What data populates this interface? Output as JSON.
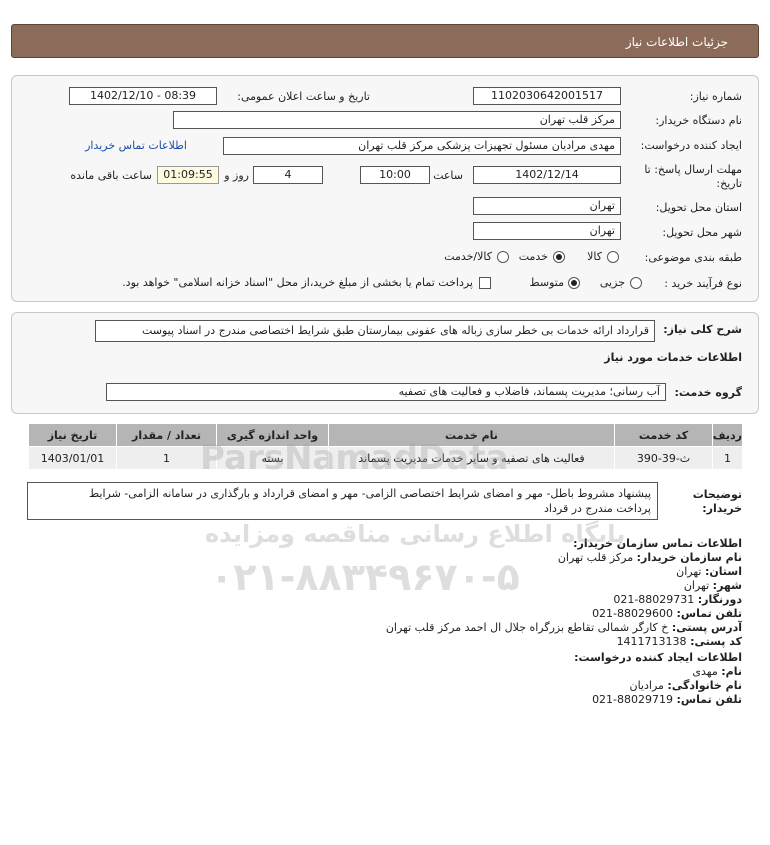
{
  "header": {
    "title": "جزئیات اطلاعات نیاز"
  },
  "form": {
    "need_number_label": "شماره نیاز:",
    "need_number": "1102030642001517",
    "announce_label": "تاریخ و ساعت اعلان عمومی:",
    "announce_value": "1402/12/10 - 08:39",
    "buyer_label": "نام دستگاه خریدار:",
    "buyer_value": "مرکز قلب تهران",
    "creator_label": "ایجاد کننده درخواست:",
    "creator_value": "مهدی مرادیان مسئول تجهیزات پزشکی مرکز قلب تهران",
    "contact_link": "اطلاعات تماس خریدار",
    "deadline_label_1": "مهلت ارسال پاسخ: تا",
    "deadline_label_2": "تاریخ:",
    "deadline_date": "1402/12/14",
    "time_label": "ساعت",
    "deadline_time": "10:00",
    "days_value": "4",
    "days_label": "روز و",
    "remaining_time": "01:09:55",
    "remaining_label": "ساعت باقی مانده",
    "province_label": "استان محل تحویل:",
    "province_value": "تهران",
    "city_label": "شهر محل تحویل:",
    "city_value": "تهران",
    "category_label": "طبقه بندی موضوعی:",
    "category_options": [
      "کالا",
      "خدمت",
      "کالا/خدمت"
    ],
    "category_selected": "خدمت",
    "process_label": "نوع فرآیند خرید :",
    "process_options": [
      "جزیی",
      "متوسط"
    ],
    "process_selected": "متوسط",
    "payment_note": "پرداخت تمام یا بخشی از مبلغ خرید،از محل \"اسناد خزانه اسلامی\" خواهد بود."
  },
  "summary": {
    "label": "شرح کلی نیاز:",
    "value": "قرارداد ارائه خدمات بی خطر سازی زباله های عفونی بیمارستان طبق شرایط اختصاصی مندرج در اسناد پیوست"
  },
  "services": {
    "title": "اطلاعات خدمات مورد نیاز",
    "group_label": "گروه خدمت:",
    "group_value": "آب رسانی؛ مدیریت پسماند، فاضلاب و فعالیت های تصفیه",
    "columns": [
      "ردیف",
      "کد خدمت",
      "نام خدمت",
      "واحد اندازه گیری",
      "تعداد / مقدار",
      "تاریخ نیاز"
    ],
    "rows": [
      [
        "1",
        "ث-39-390",
        "فعالیت های تصفیه و سایر خدمات مدیریت پسماند",
        "بسته",
        "1",
        "1403/01/01"
      ]
    ]
  },
  "notes": {
    "label_1": "توضیحات",
    "label_2": "خریدار:",
    "line_1": "پیشنهاد مشروط باطل- مهر و امضای شرایط اختصاصی الزامی- مهر و امضای قرارداد و بارگذاری در سامانه الزامی- شرایط",
    "line_2": "پرداخت مندرج در قرداد"
  },
  "buyer_contact": {
    "title": "اطلاعات تماس سازمان خریدار:",
    "org_label": "نام سازمان خریدار:",
    "org_value": "مرکز قلب تهران",
    "province_label": "استان:",
    "province_value": "تهران",
    "city_label": "شهر:",
    "city_value": "تهران",
    "fax_label": "دورنگار:",
    "fax_value": "021-88029731",
    "phone_label": "تلفن تماس:",
    "phone_value": "021-88029600",
    "address_label": "آدرس پستی:",
    "address_value": "خ کارگر شمالی تقاطع بزرگراه جلال ال احمد مرکز قلب تهران",
    "postal_label": "کد پستی:",
    "postal_value": "1411713138"
  },
  "creator_contact": {
    "title": "اطلاعات ایجاد کننده درخواست:",
    "name_label": "نام:",
    "name_value": "مهدی",
    "family_label": "نام خانوادگی:",
    "family_value": "مرادیان",
    "phone_label": "تلفن تماس:",
    "phone_value": "021-88029719"
  },
  "watermark": {
    "brand": "ParsNamadData",
    "slogan": "پایگاه اطلاع رسانی مناقصه ومزایده",
    "phone": "۰۲۱-۸۸۳۴۹۶۷۰-۵"
  }
}
